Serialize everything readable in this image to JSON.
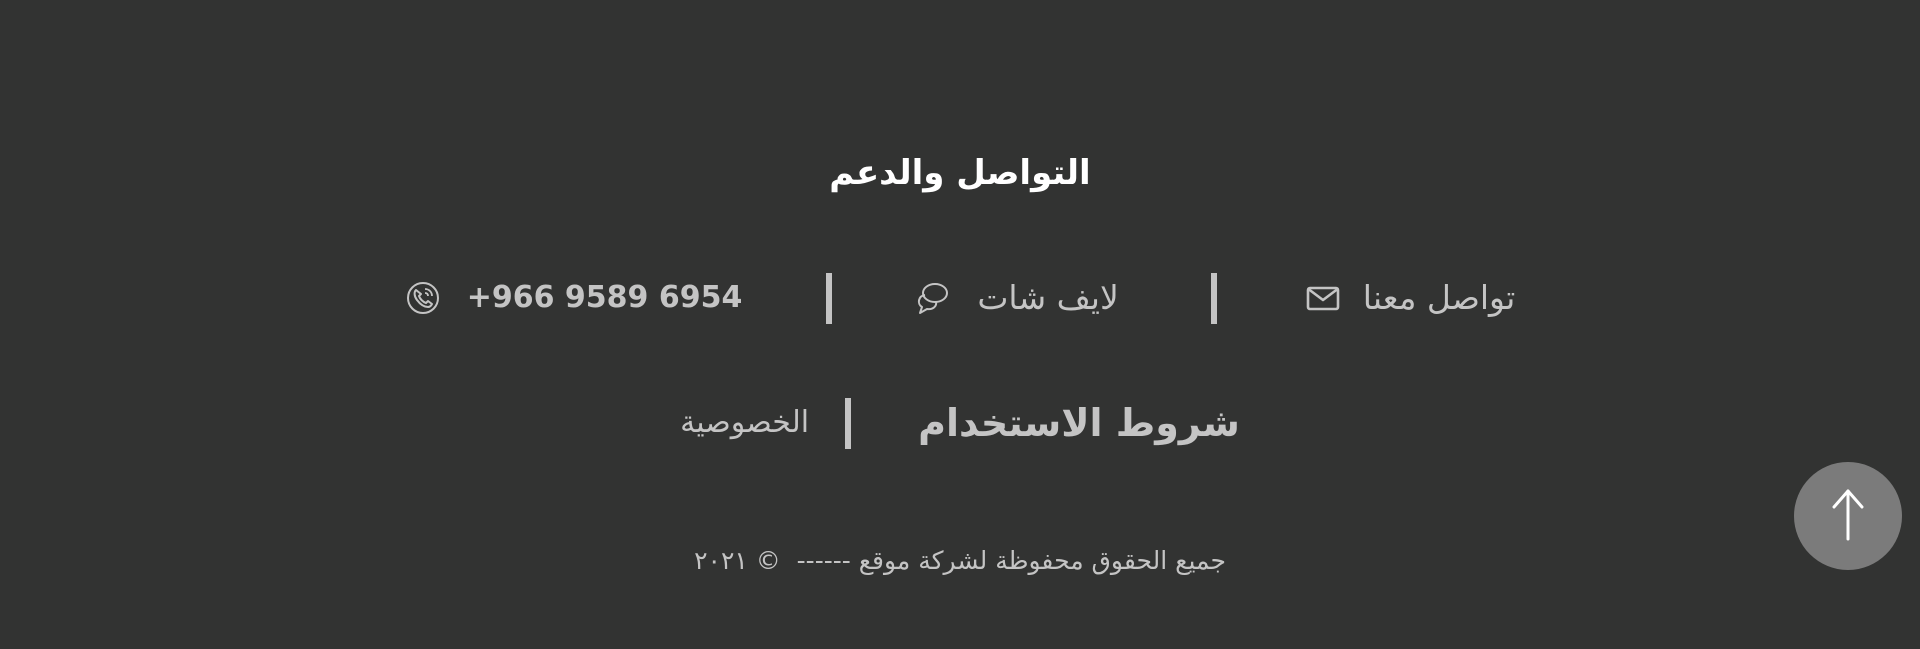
{
  "footer": {
    "title": "التواصل والدعم",
    "contact": {
      "contact_us_label": "تواصل معنا",
      "live_chat_label": "لايف شات",
      "phone_label": "+966 9589 6954"
    },
    "links": {
      "terms_label": "شروط الاستخدام",
      "privacy_label": "الخصوصية"
    },
    "copyright": "جميع الحقوق محفوظة لشركة موقع ------  © ٢٠٢١"
  },
  "icons": {
    "contact_us": "envelope-icon",
    "live_chat": "chat-bubbles-icon",
    "phone": "phone-icon",
    "scroll_top": "arrow-up-icon"
  },
  "colors": {
    "background": "#323332",
    "text": "#c4c4c4",
    "title": "#ffffff",
    "scroll_button": "#7b7b7b"
  }
}
